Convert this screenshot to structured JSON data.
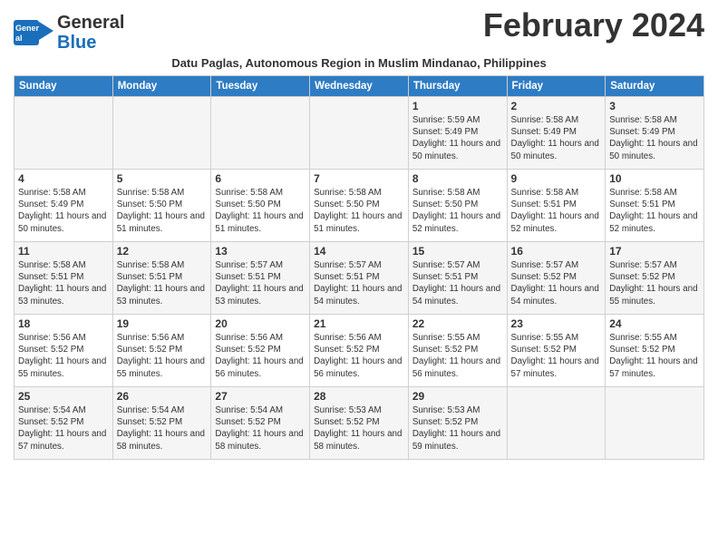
{
  "logo": {
    "line1": "General",
    "line2": "Blue"
  },
  "title": "February 2024",
  "subtitle": "Datu Paglas, Autonomous Region in Muslim Mindanao, Philippines",
  "weekdays": [
    "Sunday",
    "Monday",
    "Tuesday",
    "Wednesday",
    "Thursday",
    "Friday",
    "Saturday"
  ],
  "weeks": [
    [
      {
        "day": "",
        "info": ""
      },
      {
        "day": "",
        "info": ""
      },
      {
        "day": "",
        "info": ""
      },
      {
        "day": "",
        "info": ""
      },
      {
        "day": "1",
        "info": "Sunrise: 5:59 AM\nSunset: 5:49 PM\nDaylight: 11 hours and 50 minutes."
      },
      {
        "day": "2",
        "info": "Sunrise: 5:58 AM\nSunset: 5:49 PM\nDaylight: 11 hours and 50 minutes."
      },
      {
        "day": "3",
        "info": "Sunrise: 5:58 AM\nSunset: 5:49 PM\nDaylight: 11 hours and 50 minutes."
      }
    ],
    [
      {
        "day": "4",
        "info": "Sunrise: 5:58 AM\nSunset: 5:49 PM\nDaylight: 11 hours and 50 minutes."
      },
      {
        "day": "5",
        "info": "Sunrise: 5:58 AM\nSunset: 5:50 PM\nDaylight: 11 hours and 51 minutes."
      },
      {
        "day": "6",
        "info": "Sunrise: 5:58 AM\nSunset: 5:50 PM\nDaylight: 11 hours and 51 minutes."
      },
      {
        "day": "7",
        "info": "Sunrise: 5:58 AM\nSunset: 5:50 PM\nDaylight: 11 hours and 51 minutes."
      },
      {
        "day": "8",
        "info": "Sunrise: 5:58 AM\nSunset: 5:50 PM\nDaylight: 11 hours and 52 minutes."
      },
      {
        "day": "9",
        "info": "Sunrise: 5:58 AM\nSunset: 5:51 PM\nDaylight: 11 hours and 52 minutes."
      },
      {
        "day": "10",
        "info": "Sunrise: 5:58 AM\nSunset: 5:51 PM\nDaylight: 11 hours and 52 minutes."
      }
    ],
    [
      {
        "day": "11",
        "info": "Sunrise: 5:58 AM\nSunset: 5:51 PM\nDaylight: 11 hours and 53 minutes."
      },
      {
        "day": "12",
        "info": "Sunrise: 5:58 AM\nSunset: 5:51 PM\nDaylight: 11 hours and 53 minutes."
      },
      {
        "day": "13",
        "info": "Sunrise: 5:57 AM\nSunset: 5:51 PM\nDaylight: 11 hours and 53 minutes."
      },
      {
        "day": "14",
        "info": "Sunrise: 5:57 AM\nSunset: 5:51 PM\nDaylight: 11 hours and 54 minutes."
      },
      {
        "day": "15",
        "info": "Sunrise: 5:57 AM\nSunset: 5:51 PM\nDaylight: 11 hours and 54 minutes."
      },
      {
        "day": "16",
        "info": "Sunrise: 5:57 AM\nSunset: 5:52 PM\nDaylight: 11 hours and 54 minutes."
      },
      {
        "day": "17",
        "info": "Sunrise: 5:57 AM\nSunset: 5:52 PM\nDaylight: 11 hours and 55 minutes."
      }
    ],
    [
      {
        "day": "18",
        "info": "Sunrise: 5:56 AM\nSunset: 5:52 PM\nDaylight: 11 hours and 55 minutes."
      },
      {
        "day": "19",
        "info": "Sunrise: 5:56 AM\nSunset: 5:52 PM\nDaylight: 11 hours and 55 minutes."
      },
      {
        "day": "20",
        "info": "Sunrise: 5:56 AM\nSunset: 5:52 PM\nDaylight: 11 hours and 56 minutes."
      },
      {
        "day": "21",
        "info": "Sunrise: 5:56 AM\nSunset: 5:52 PM\nDaylight: 11 hours and 56 minutes."
      },
      {
        "day": "22",
        "info": "Sunrise: 5:55 AM\nSunset: 5:52 PM\nDaylight: 11 hours and 56 minutes."
      },
      {
        "day": "23",
        "info": "Sunrise: 5:55 AM\nSunset: 5:52 PM\nDaylight: 11 hours and 57 minutes."
      },
      {
        "day": "24",
        "info": "Sunrise: 5:55 AM\nSunset: 5:52 PM\nDaylight: 11 hours and 57 minutes."
      }
    ],
    [
      {
        "day": "25",
        "info": "Sunrise: 5:54 AM\nSunset: 5:52 PM\nDaylight: 11 hours and 57 minutes."
      },
      {
        "day": "26",
        "info": "Sunrise: 5:54 AM\nSunset: 5:52 PM\nDaylight: 11 hours and 58 minutes."
      },
      {
        "day": "27",
        "info": "Sunrise: 5:54 AM\nSunset: 5:52 PM\nDaylight: 11 hours and 58 minutes."
      },
      {
        "day": "28",
        "info": "Sunrise: 5:53 AM\nSunset: 5:52 PM\nDaylight: 11 hours and 58 minutes."
      },
      {
        "day": "29",
        "info": "Sunrise: 5:53 AM\nSunset: 5:52 PM\nDaylight: 11 hours and 59 minutes."
      },
      {
        "day": "",
        "info": ""
      },
      {
        "day": "",
        "info": ""
      }
    ]
  ]
}
